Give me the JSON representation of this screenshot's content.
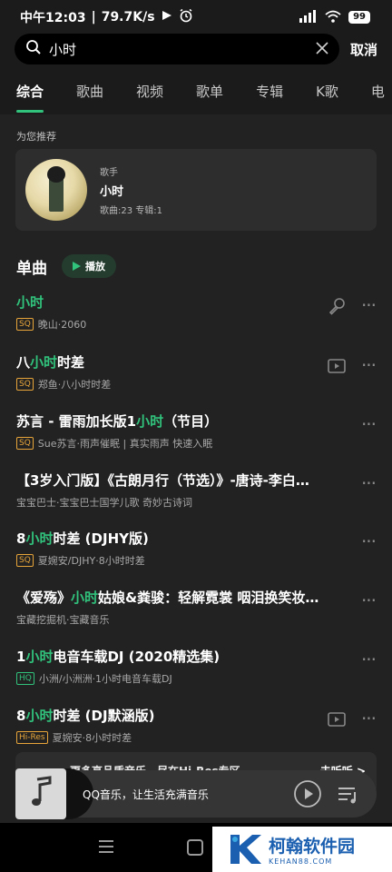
{
  "status_bar": {
    "time": "中午12:03",
    "speed": "79.7K/s",
    "signal": "4G",
    "battery": "99"
  },
  "search": {
    "query": "小时",
    "cancel_label": "取消"
  },
  "tabs": [
    {
      "label": "综合",
      "active": true
    },
    {
      "label": "歌曲"
    },
    {
      "label": "视频"
    },
    {
      "label": "歌单"
    },
    {
      "label": "专辑"
    },
    {
      "label": "K歌"
    },
    {
      "label": "电"
    }
  ],
  "recommend": {
    "heading": "为您推荐",
    "type": "歌手",
    "name": "小时",
    "stats": "歌曲:23 专辑:1"
  },
  "singles": {
    "title": "单曲",
    "play_label": "播放",
    "songs": [
      {
        "pre": "",
        "hl": "小时",
        "post": "",
        "badge": "SQ",
        "badge_type": "sq",
        "sub": "晚山·2060",
        "action": "mic-icon"
      },
      {
        "pre": "八",
        "hl": "小时",
        "post": "时差",
        "badge": "SQ",
        "badge_type": "sq",
        "sub": "郑鱼·八小时时差",
        "action": "video-icon"
      },
      {
        "pre": "苏言 - 雷雨加长版1",
        "hl": "小时",
        "post": "（节目）",
        "badge": "SQ",
        "badge_type": "sq",
        "sub": "Sue苏言·雨声催眠 | 真实雨声 快速入眠",
        "action": ""
      },
      {
        "pre": "【3岁入门版】《古朗月行（节选）》-唐诗-李白…",
        "hl": "",
        "post": "",
        "badge": "",
        "badge_type": "",
        "sub": "宝宝巴士·宝宝巴士国学儿歌 奇妙古诗词",
        "action": ""
      },
      {
        "pre": "8",
        "hl": "小时",
        "post": "时差 (DJHY版)",
        "badge": "SQ",
        "badge_type": "sq",
        "sub": "夏婉安/DJHY·8小时时差",
        "action": ""
      },
      {
        "pre": "《爱殇》",
        "hl": "小时",
        "post": "姑娘&粪骏：轻解霓裳 咽泪换笑妆…",
        "badge": "",
        "badge_type": "",
        "sub": "宝藏挖掘机·宝藏音乐",
        "action": ""
      },
      {
        "pre": "1",
        "hl": "小时",
        "post": "电音车载DJ (2020精选集)",
        "badge": "HQ",
        "badge_type": "hq",
        "sub": "小洲/小洲洲·1小时电音车载DJ",
        "action": ""
      },
      {
        "pre": "8",
        "hl": "小时",
        "post": "时差 (DJ默涵版)",
        "badge": "Hi-Res",
        "badge_type": "hires",
        "sub": "夏婉安·8小时时差",
        "action": "video-icon"
      }
    ]
  },
  "hires_banner": {
    "text": "更多高品质音乐，尽在Hi-Res专区",
    "link": "去听听 >"
  },
  "player": {
    "title": "QQ音乐，让生活充满音乐"
  },
  "watermark": {
    "title": "柯翰软件园",
    "url": "KEHAN88.COM"
  },
  "colors": {
    "accent": "#31c27c",
    "badge_sq": "#e7a53a",
    "background": "#222222"
  }
}
